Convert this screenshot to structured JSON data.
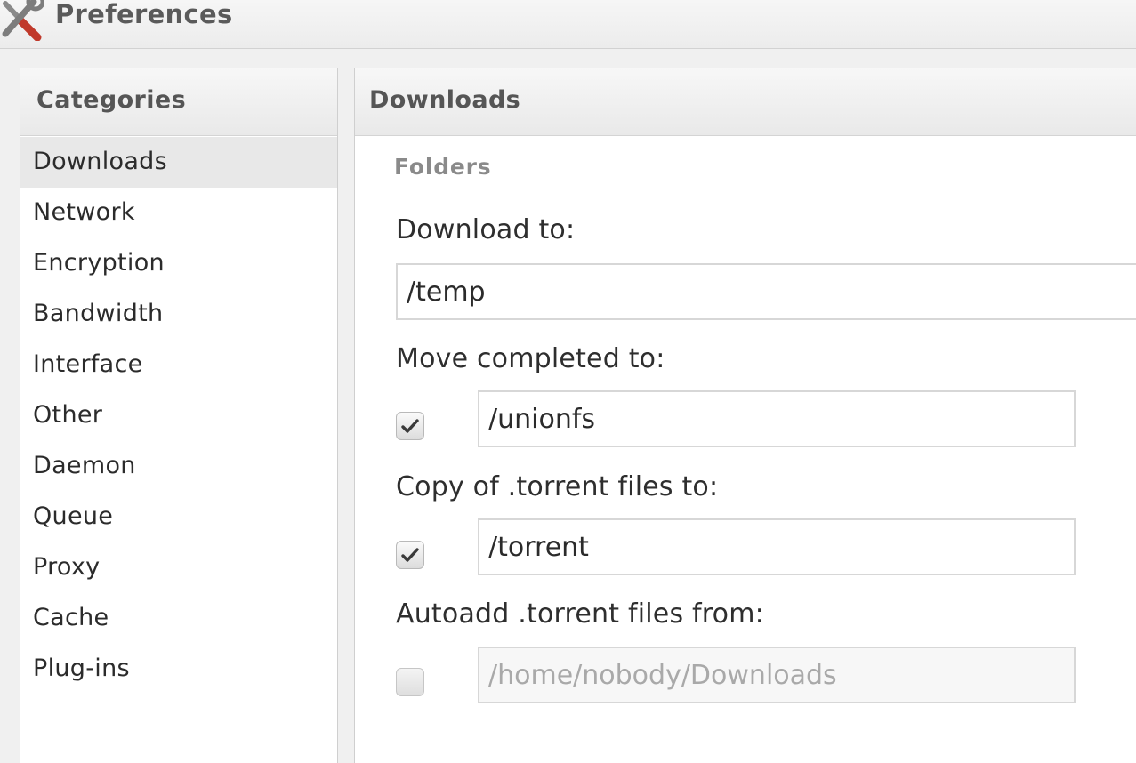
{
  "window": {
    "title": "Preferences",
    "icon": "preferences-tools-icon"
  },
  "sidebar": {
    "header": "Categories",
    "items": [
      {
        "label": "Downloads",
        "selected": true
      },
      {
        "label": "Network",
        "selected": false
      },
      {
        "label": "Encryption",
        "selected": false
      },
      {
        "label": "Bandwidth",
        "selected": false
      },
      {
        "label": "Interface",
        "selected": false
      },
      {
        "label": "Other",
        "selected": false
      },
      {
        "label": "Daemon",
        "selected": false
      },
      {
        "label": "Queue",
        "selected": false
      },
      {
        "label": "Proxy",
        "selected": false
      },
      {
        "label": "Cache",
        "selected": false
      },
      {
        "label": "Plug-ins",
        "selected": false
      }
    ]
  },
  "main": {
    "header": "Downloads",
    "section_title": "Folders",
    "download_to": {
      "label": "Download to:",
      "value": "/temp"
    },
    "move_completed": {
      "label": "Move completed to:",
      "checked": true,
      "value": "/unionfs"
    },
    "copy_torrent": {
      "label": "Copy of .torrent files to:",
      "checked": true,
      "value": "/torrent"
    },
    "autoadd": {
      "label": "Autoadd .torrent files from:",
      "checked": false,
      "placeholder": "/home/nobody/Downloads"
    }
  },
  "colors": {
    "selected_bg": "#e8e8e8",
    "header_text": "#555555",
    "section_text": "#8a8a8a",
    "disabled_text": "#a9a9a9"
  }
}
